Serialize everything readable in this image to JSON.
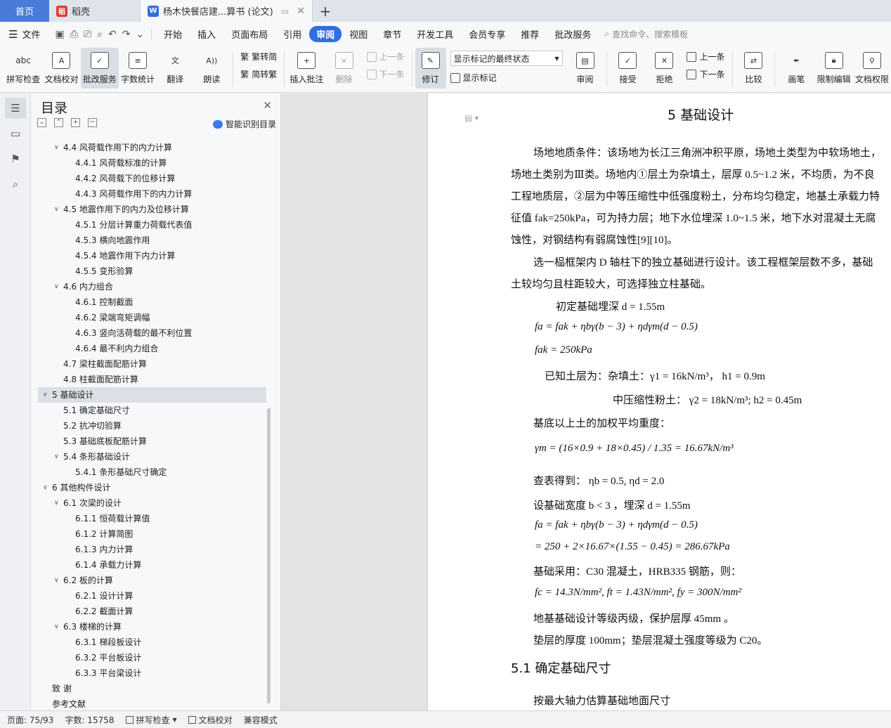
{
  "tabs": {
    "home": "首页",
    "daoke": "稻壳",
    "doc": "杨木快餐店建...算书 (论文)",
    "new_tab": "+"
  },
  "menu": {
    "file": "文件",
    "items": [
      "开始",
      "插入",
      "页面布局",
      "引用",
      "审阅",
      "视图",
      "章节",
      "开发工具",
      "会员专享",
      "推荐",
      "批改服务"
    ],
    "active": "审阅",
    "search": "查找命令、搜索模板"
  },
  "ribbon": {
    "spell": "拼写检查",
    "doc_check": "文档校对",
    "correct": "批改服务",
    "wordcount": "字数统计",
    "translate": "翻译",
    "read": "朗读",
    "to_trad": "繁转简",
    "to_simp": "简转繁",
    "insert_comment": "插入批注",
    "delete": "删除",
    "prev_comment": "上一条",
    "next_comment": "下一条",
    "track": "修订",
    "mark_state": "显示标记的最终状态",
    "show_marks": "显示标记",
    "review": "审阅",
    "accept": "接受",
    "reject": "拒绝",
    "prev": "上一条",
    "next": "下一条",
    "compare": "比较",
    "pen": "画笔",
    "restrict": "限制编辑",
    "doc_perm": "文档权限"
  },
  "toc": {
    "title": "目录",
    "smart": "智能识别目录",
    "items": [
      {
        "level": 2,
        "text": "4.4  风荷载作用下的内力计算",
        "caret": "v"
      },
      {
        "level": 3,
        "text": "4.4.1  风荷载标准的计算"
      },
      {
        "level": 3,
        "text": "4.4.2  风荷载下的位移计算"
      },
      {
        "level": 3,
        "text": "4.4.3  风荷载作用下的内力计算"
      },
      {
        "level": 2,
        "text": "4.5  地震作用下的内力及位移计算",
        "caret": "v"
      },
      {
        "level": 3,
        "text": "4.5.1  分层计算重力荷载代表值"
      },
      {
        "level": 3,
        "text": "4.5.3  横向地震作用"
      },
      {
        "level": 3,
        "text": "4.5.4  地震作用下内力计算"
      },
      {
        "level": 3,
        "text": "4.5.5  变形验算"
      },
      {
        "level": 2,
        "text": "4.6  内力组合",
        "caret": "v"
      },
      {
        "level": 3,
        "text": "4.6.1  控制截面"
      },
      {
        "level": 3,
        "text": "4.6.2  梁端弯矩调幅"
      },
      {
        "level": 3,
        "text": "4.6.3  竖向活荷载的最不利位置"
      },
      {
        "level": 3,
        "text": "4.6.4  最不利内力组合"
      },
      {
        "level": 2,
        "text": "4.7  梁柱截面配筋计算"
      },
      {
        "level": 2,
        "text": "4.8  柱截面配筋计算"
      },
      {
        "level": 1,
        "text": "5  基础设计",
        "caret": "v",
        "selected": true
      },
      {
        "level": 2,
        "text": "5.1  确定基础尺寸"
      },
      {
        "level": 2,
        "text": "5.2  抗冲切验算"
      },
      {
        "level": 2,
        "text": "5.3  基础底板配筋计算"
      },
      {
        "level": 2,
        "text": "5.4  条形基础设计",
        "caret": "v"
      },
      {
        "level": 3,
        "text": "5.4.1  条形基础尺寸确定"
      },
      {
        "level": 1,
        "text": "6  其他构件设计",
        "caret": "v"
      },
      {
        "level": 2,
        "text": "6.1  次梁的设计",
        "caret": "v"
      },
      {
        "level": 3,
        "text": "6.1.1  恒荷载计算值"
      },
      {
        "level": 3,
        "text": "6.1.2  计算简图"
      },
      {
        "level": 3,
        "text": "6.1.3  内力计算"
      },
      {
        "level": 3,
        "text": "6.1.4  承载力计算"
      },
      {
        "level": 2,
        "text": "6.2  板的计算",
        "caret": "v"
      },
      {
        "level": 3,
        "text": "6.2.1  设计计算"
      },
      {
        "level": 3,
        "text": "6.2.2  截面计算"
      },
      {
        "level": 2,
        "text": "6.3  楼梯的计算",
        "caret": "v"
      },
      {
        "level": 3,
        "text": "6.3.1  梯段板设计"
      },
      {
        "level": 3,
        "text": "6.3.2  平台板设计"
      },
      {
        "level": 3,
        "text": "6.3.3  平台梁设计"
      },
      {
        "level": 1,
        "text": "致    谢"
      },
      {
        "level": 1,
        "text": "参考文献"
      }
    ]
  },
  "document": {
    "heading": "5  基础设计",
    "lines": [
      "场地地质条件：该场地为长江三角洲冲积平原，场地土类型为中软场地土，",
      "场地土类别为Ⅲ类。场地内①层土为杂填土，层厚 0.5~1.2 米，不均质，为不良",
      "工程地质层，②层为中等压缩性中低强度粉土，分布均匀稳定，地基土承载力特",
      "征值 fak=250kPa，可为持力层；地下水位埋深 1.0~1.5 米，地下水对混凝土无腐",
      "蚀性，对钢结构有弱腐蚀性[9][10]。",
      "选一榀框架内 D 轴柱下的独立基础进行设计。该工程框架层数不多，基础",
      "土较均匀且柱距较大，可选择独立柱基础。",
      "初定基础埋深 d = 1.55m",
      "fa = fak + ηbγ(b − 3) + ηdγm(d − 0.5)",
      "fak = 250kPa",
      "已知土层为：杂填土：γ1 = 16kN/m³，  h1 = 0.9m",
      "中压缩性粉土：  γ2 = 18kN/m³; h2 = 0.45m",
      "基底以上土的加权平均重度：",
      "γm = (16×0.9 + 18×0.45) / 1.35 = 16.67kN/m³",
      "查表得到：  ηb = 0.5, ηd = 2.0",
      "设基础宽度 b < 3 ，埋深 d = 1.55m",
      "fa = fak + ηbγ(b − 3) + ηdγm(d − 0.5)",
      "= 250 + 2×16.67×(1.55 − 0.45) = 286.67kPa",
      "基础采用：C30 混凝土，HRB335 钢筋，则：",
      "fc = 14.3N/mm², ft = 1.43N/mm², fy = 300N/mm²",
      "地基基础设计等级丙级，保护层厚 45mm 。",
      "垫层的厚度 100mm；垫层混凝土强度等级为 C20。"
    ],
    "subheading": "5.1  确定基础尺寸",
    "last_line": "按最大轴力估算基础地面尺寸"
  },
  "status": {
    "page": "页面: 75/93",
    "words": "字数: 15758",
    "spell": "拼写检查",
    "check": "文档校对",
    "compat": "兼容模式"
  }
}
